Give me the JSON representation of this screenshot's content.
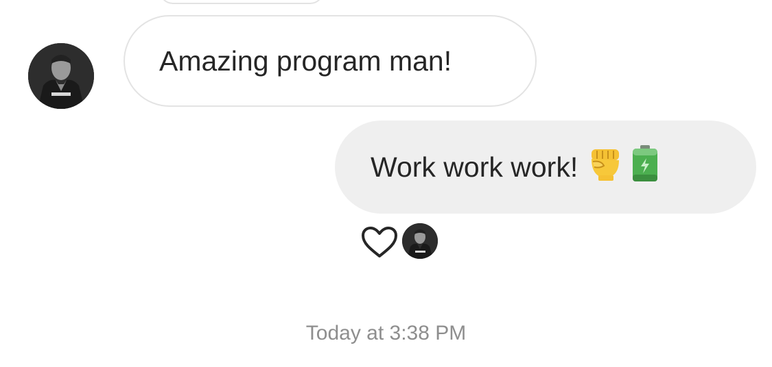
{
  "thread": {
    "messages": [
      {
        "sender": "other",
        "text": "Amazing program man!"
      },
      {
        "sender": "me",
        "text": "Work work work!",
        "emojis": [
          "raised-fist-icon",
          "battery-icon"
        ]
      }
    ],
    "reaction": {
      "icon": "heart-icon"
    },
    "timestamp": "Today at 3:38 PM"
  },
  "colors": {
    "incoming_border": "#e3e3e3",
    "outgoing_bg": "#efefef",
    "text": "#262626",
    "timestamp": "#8e8e8e"
  }
}
